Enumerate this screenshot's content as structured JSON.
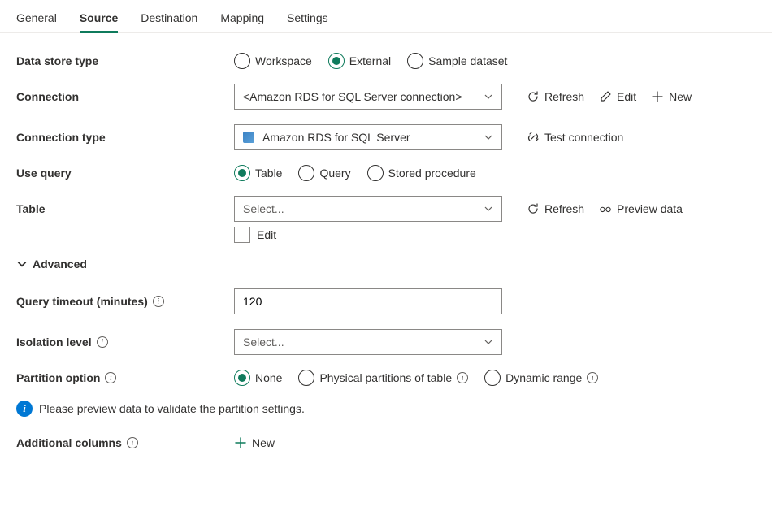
{
  "tabs": {
    "general": "General",
    "source": "Source",
    "destination": "Destination",
    "mapping": "Mapping",
    "settings": "Settings"
  },
  "labels": {
    "data_store_type": "Data store type",
    "connection": "Connection",
    "connection_type": "Connection type",
    "use_query": "Use query",
    "table": "Table",
    "advanced": "Advanced",
    "query_timeout": "Query timeout (minutes)",
    "isolation_level": "Isolation level",
    "partition_option": "Partition option",
    "additional_columns": "Additional columns"
  },
  "data_store_type": {
    "workspace": "Workspace",
    "external": "External",
    "sample": "Sample dataset"
  },
  "connection": {
    "value": "<Amazon RDS for SQL Server connection>",
    "refresh": "Refresh",
    "edit": "Edit",
    "new": "New"
  },
  "connection_type": {
    "value": "Amazon RDS for SQL Server",
    "test": "Test connection"
  },
  "use_query": {
    "table": "Table",
    "query": "Query",
    "stored": "Stored procedure"
  },
  "table": {
    "placeholder": "Select...",
    "refresh": "Refresh",
    "preview": "Preview data",
    "edit": "Edit"
  },
  "query_timeout": {
    "value": "120"
  },
  "isolation_level": {
    "placeholder": "Select..."
  },
  "partition_option": {
    "none": "None",
    "physical": "Physical partitions of table",
    "dynamic": "Dynamic range"
  },
  "info_message": "Please preview data to validate the partition settings.",
  "additional_columns": {
    "new": "New"
  }
}
